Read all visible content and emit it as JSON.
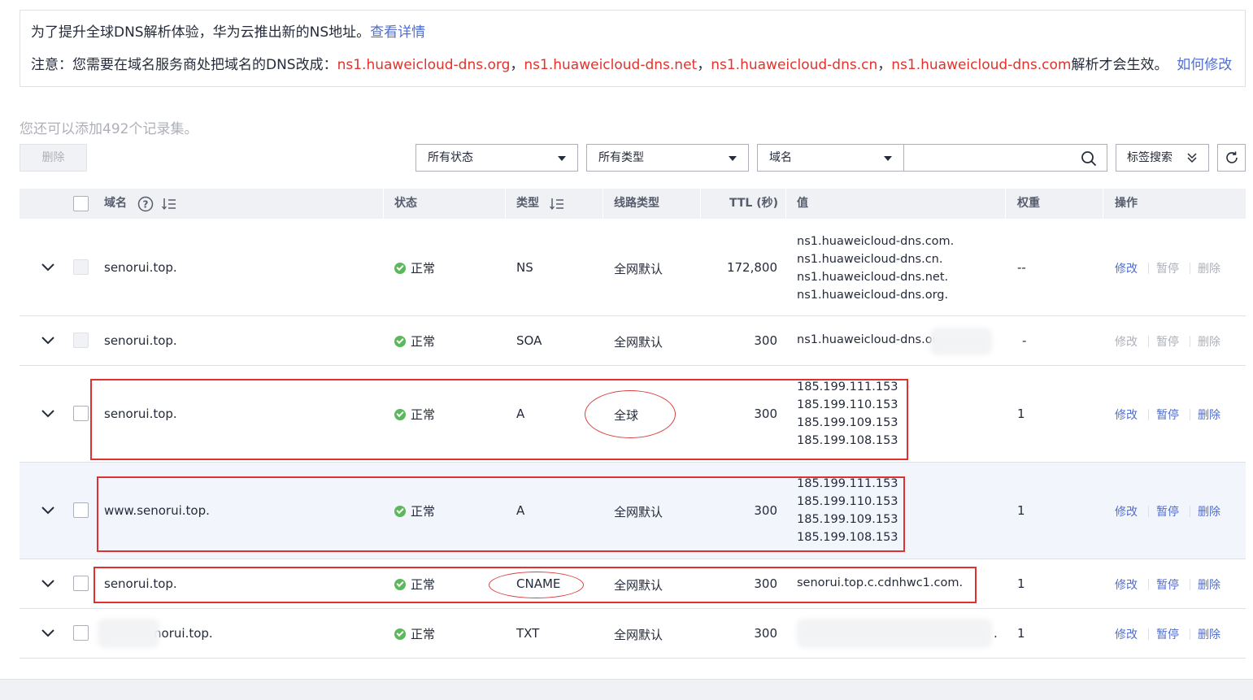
{
  "notice": {
    "line1_text": "为了提升全球DNS解析体验，华为云推出新的NS地址。",
    "line1_link": "查看详情",
    "line2_prefix": "注意：您需要在域名服务商处把域名的DNS改成：",
    "ns": [
      "ns1.huaweicloud-dns.org",
      "ns1.huaweicloud-dns.net",
      "ns1.huaweicloud-dns.cn",
      "ns1.huaweicloud-dns.com"
    ],
    "separator": "，",
    "line2_suffix": "解析才会生效。",
    "line2_link": "如何修改"
  },
  "quota_text": "您还可以添加492个记录集。",
  "toolbar": {
    "delete_label": "删除",
    "status_filter": "所有状态",
    "type_filter": "所有类型",
    "field_filter": "域名",
    "search_placeholder": "",
    "tag_search_label": "标签搜索"
  },
  "columns": {
    "domain": "域名",
    "status": "状态",
    "type": "类型",
    "line": "线路类型",
    "ttl": "TTL (秒)",
    "value": "值",
    "weight": "权重",
    "action": "操作"
  },
  "ops": {
    "edit": "修改",
    "pause": "暂停",
    "delete": "删除"
  },
  "rows": [
    {
      "domain": "senorui.top.",
      "status": "正常",
      "type": "NS",
      "line": "全网默认",
      "ttl": "172,800",
      "values": [
        "ns1.huaweicloud-dns.com.",
        "ns1.huaweicloud-dns.cn.",
        "ns1.huaweicloud-dns.net.",
        "ns1.huaweicloud-dns.org."
      ],
      "weight": "--"
    },
    {
      "domain": "senorui.top.",
      "status": "正常",
      "type": "SOA",
      "line": "全网默认",
      "ttl": "300",
      "values": [
        "ns1.huaweicloud-dns.or"
      ],
      "weight": "-"
    },
    {
      "domain": "senorui.top.",
      "status": "正常",
      "type": "A",
      "line": "全球",
      "ttl": "300",
      "values": [
        "185.199.111.153",
        "185.199.110.153",
        "185.199.109.153",
        "185.199.108.153"
      ],
      "weight": "1"
    },
    {
      "domain": "www.senorui.top.",
      "status": "正常",
      "type": "A",
      "line": "全网默认",
      "ttl": "300",
      "values": [
        "185.199.111.153",
        "185.199.110.153",
        "185.199.109.153",
        "185.199.108.153"
      ],
      "weight": "1"
    },
    {
      "domain": "senorui.top.",
      "status": "正常",
      "type": "CNAME",
      "line": "全网默认",
      "ttl": "300",
      "values": [
        "senorui.top.c.cdnhwc1.com."
      ],
      "weight": "1"
    },
    {
      "domain": "senorui.top.",
      "status": "正常",
      "type": "TXT",
      "line": "全网默认",
      "ttl": "300",
      "values": [
        "."
      ],
      "weight": "1"
    }
  ],
  "colors": {
    "link": "#526ecc",
    "ns_red": "#e0332c",
    "annotation_red": "#e03131",
    "status_green": "#5bb85b",
    "header_bg": "#eff1f5"
  }
}
